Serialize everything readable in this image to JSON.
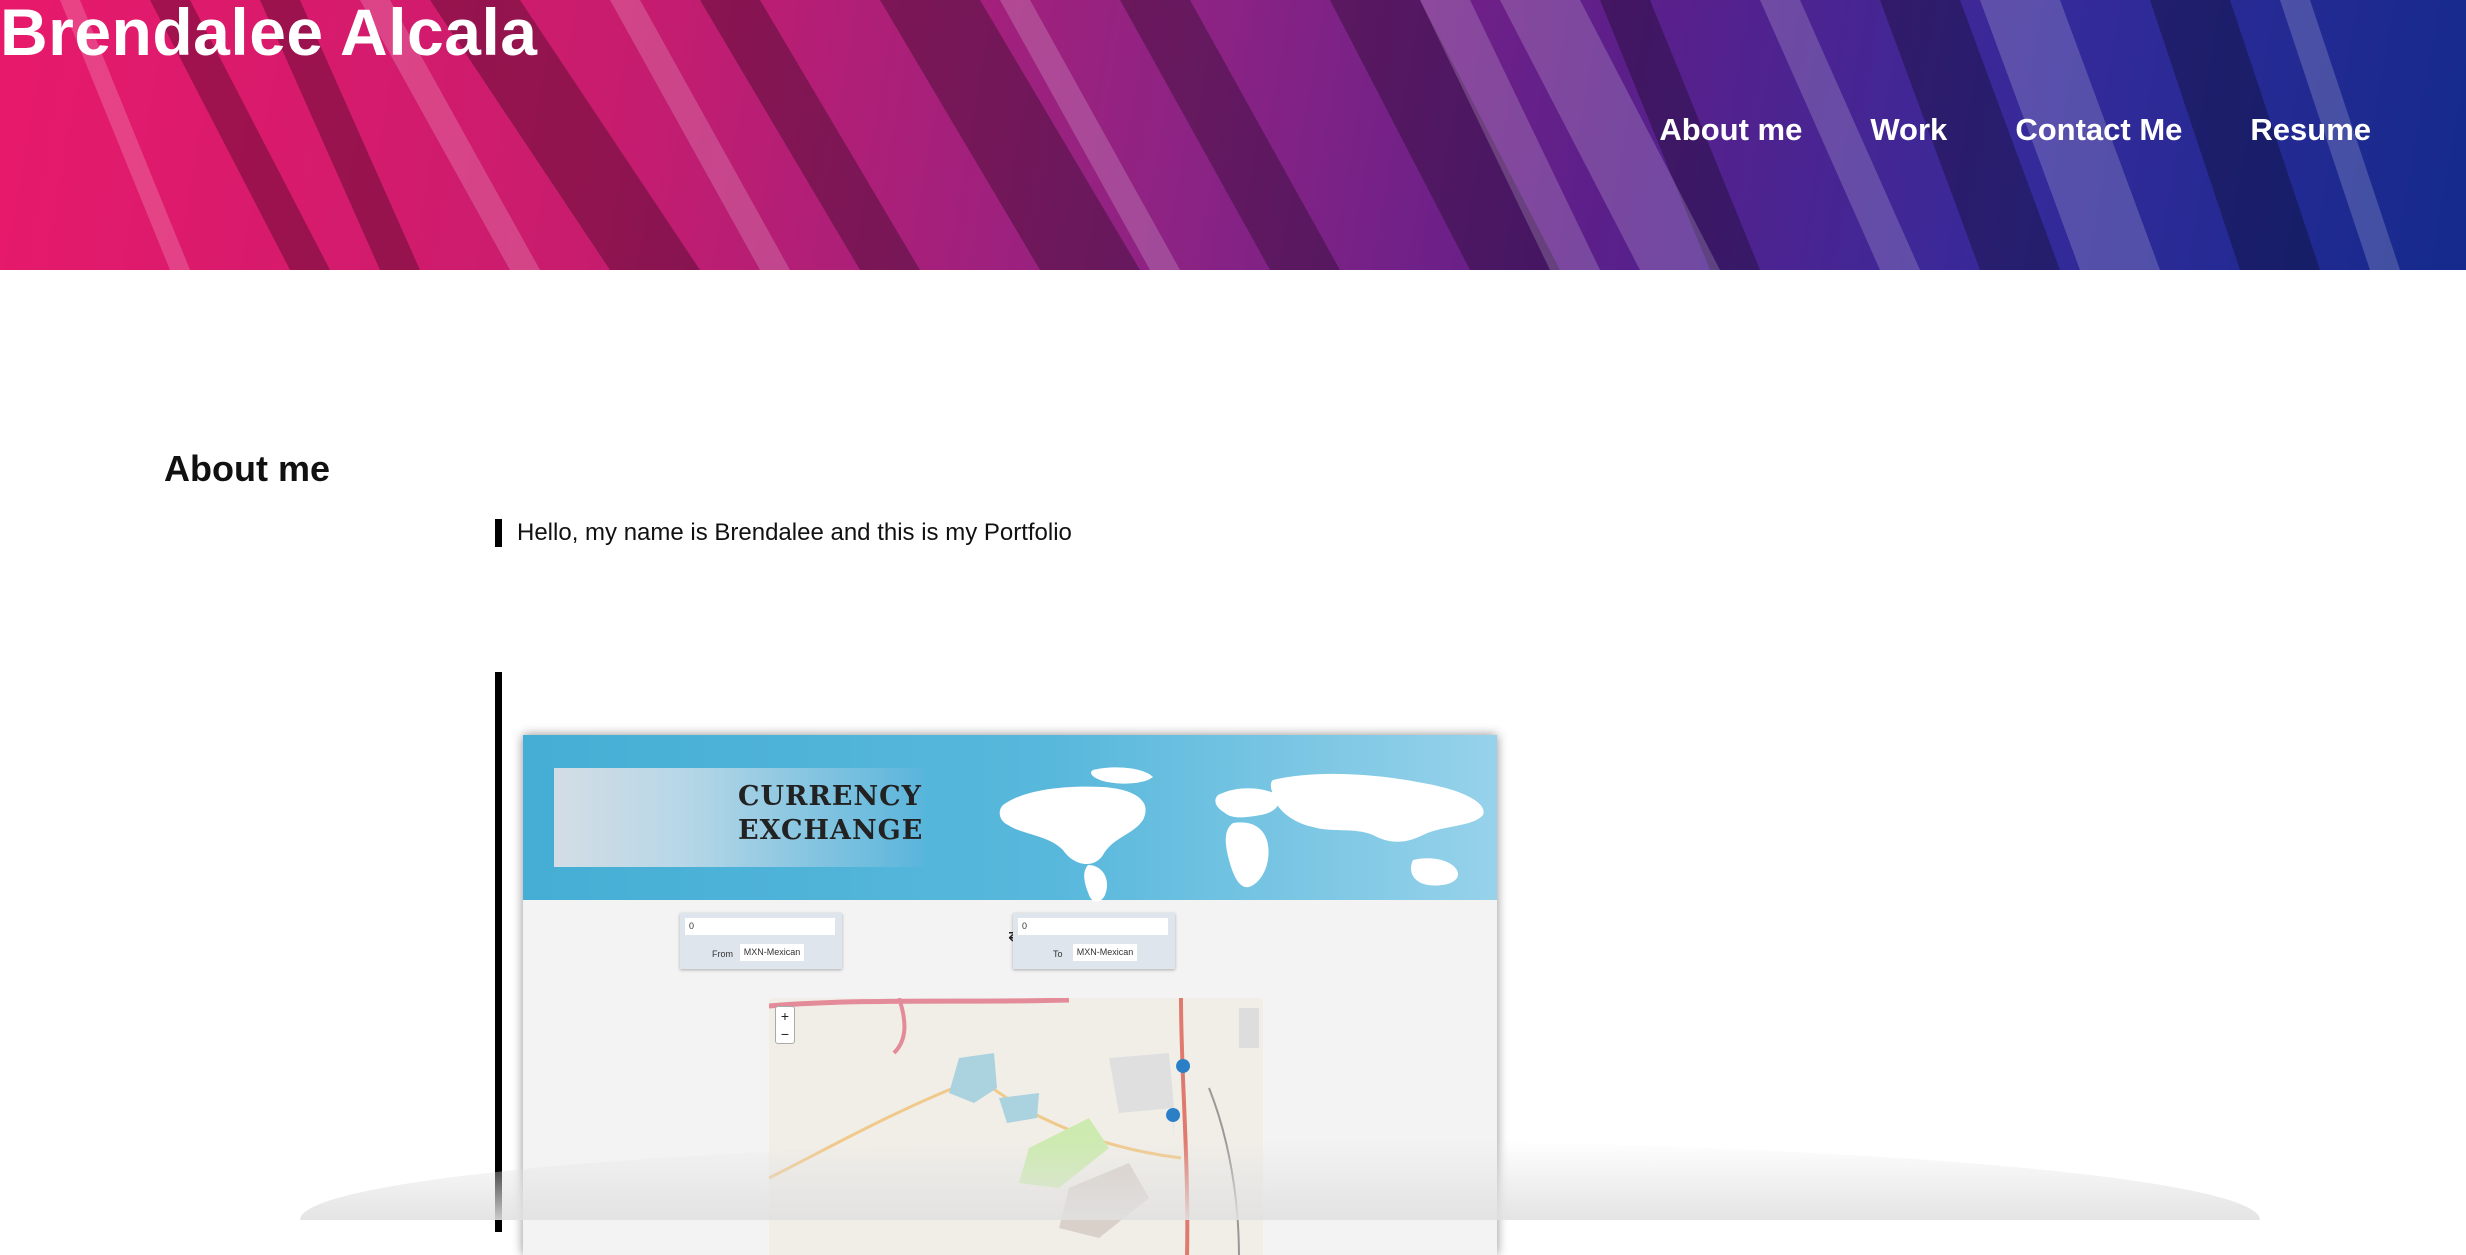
{
  "site": {
    "title": "Brendalee Alcala"
  },
  "nav": {
    "items": [
      {
        "label": "About me"
      },
      {
        "label": "Work"
      },
      {
        "label": "Contact Me"
      },
      {
        "label": "Resume"
      }
    ]
  },
  "about": {
    "heading": "About me",
    "intro": "Hello, my name is Brendalee and this is my Portfolio"
  },
  "work": {
    "project": {
      "logo_line1": "CURRENCY",
      "logo_line2": "EXCHANGE",
      "from": {
        "value": "0",
        "label": "From",
        "currency": "MXN-Mexican"
      },
      "to": {
        "value": "0",
        "label": "To",
        "currency": "MXN-Mexican"
      },
      "swap_icon": "⇄",
      "zoom_in": "+",
      "zoom_out": "−"
    }
  },
  "colors": {
    "header_start": "#e8196b",
    "header_end": "#142a8c",
    "accent_bar": "#000000"
  }
}
